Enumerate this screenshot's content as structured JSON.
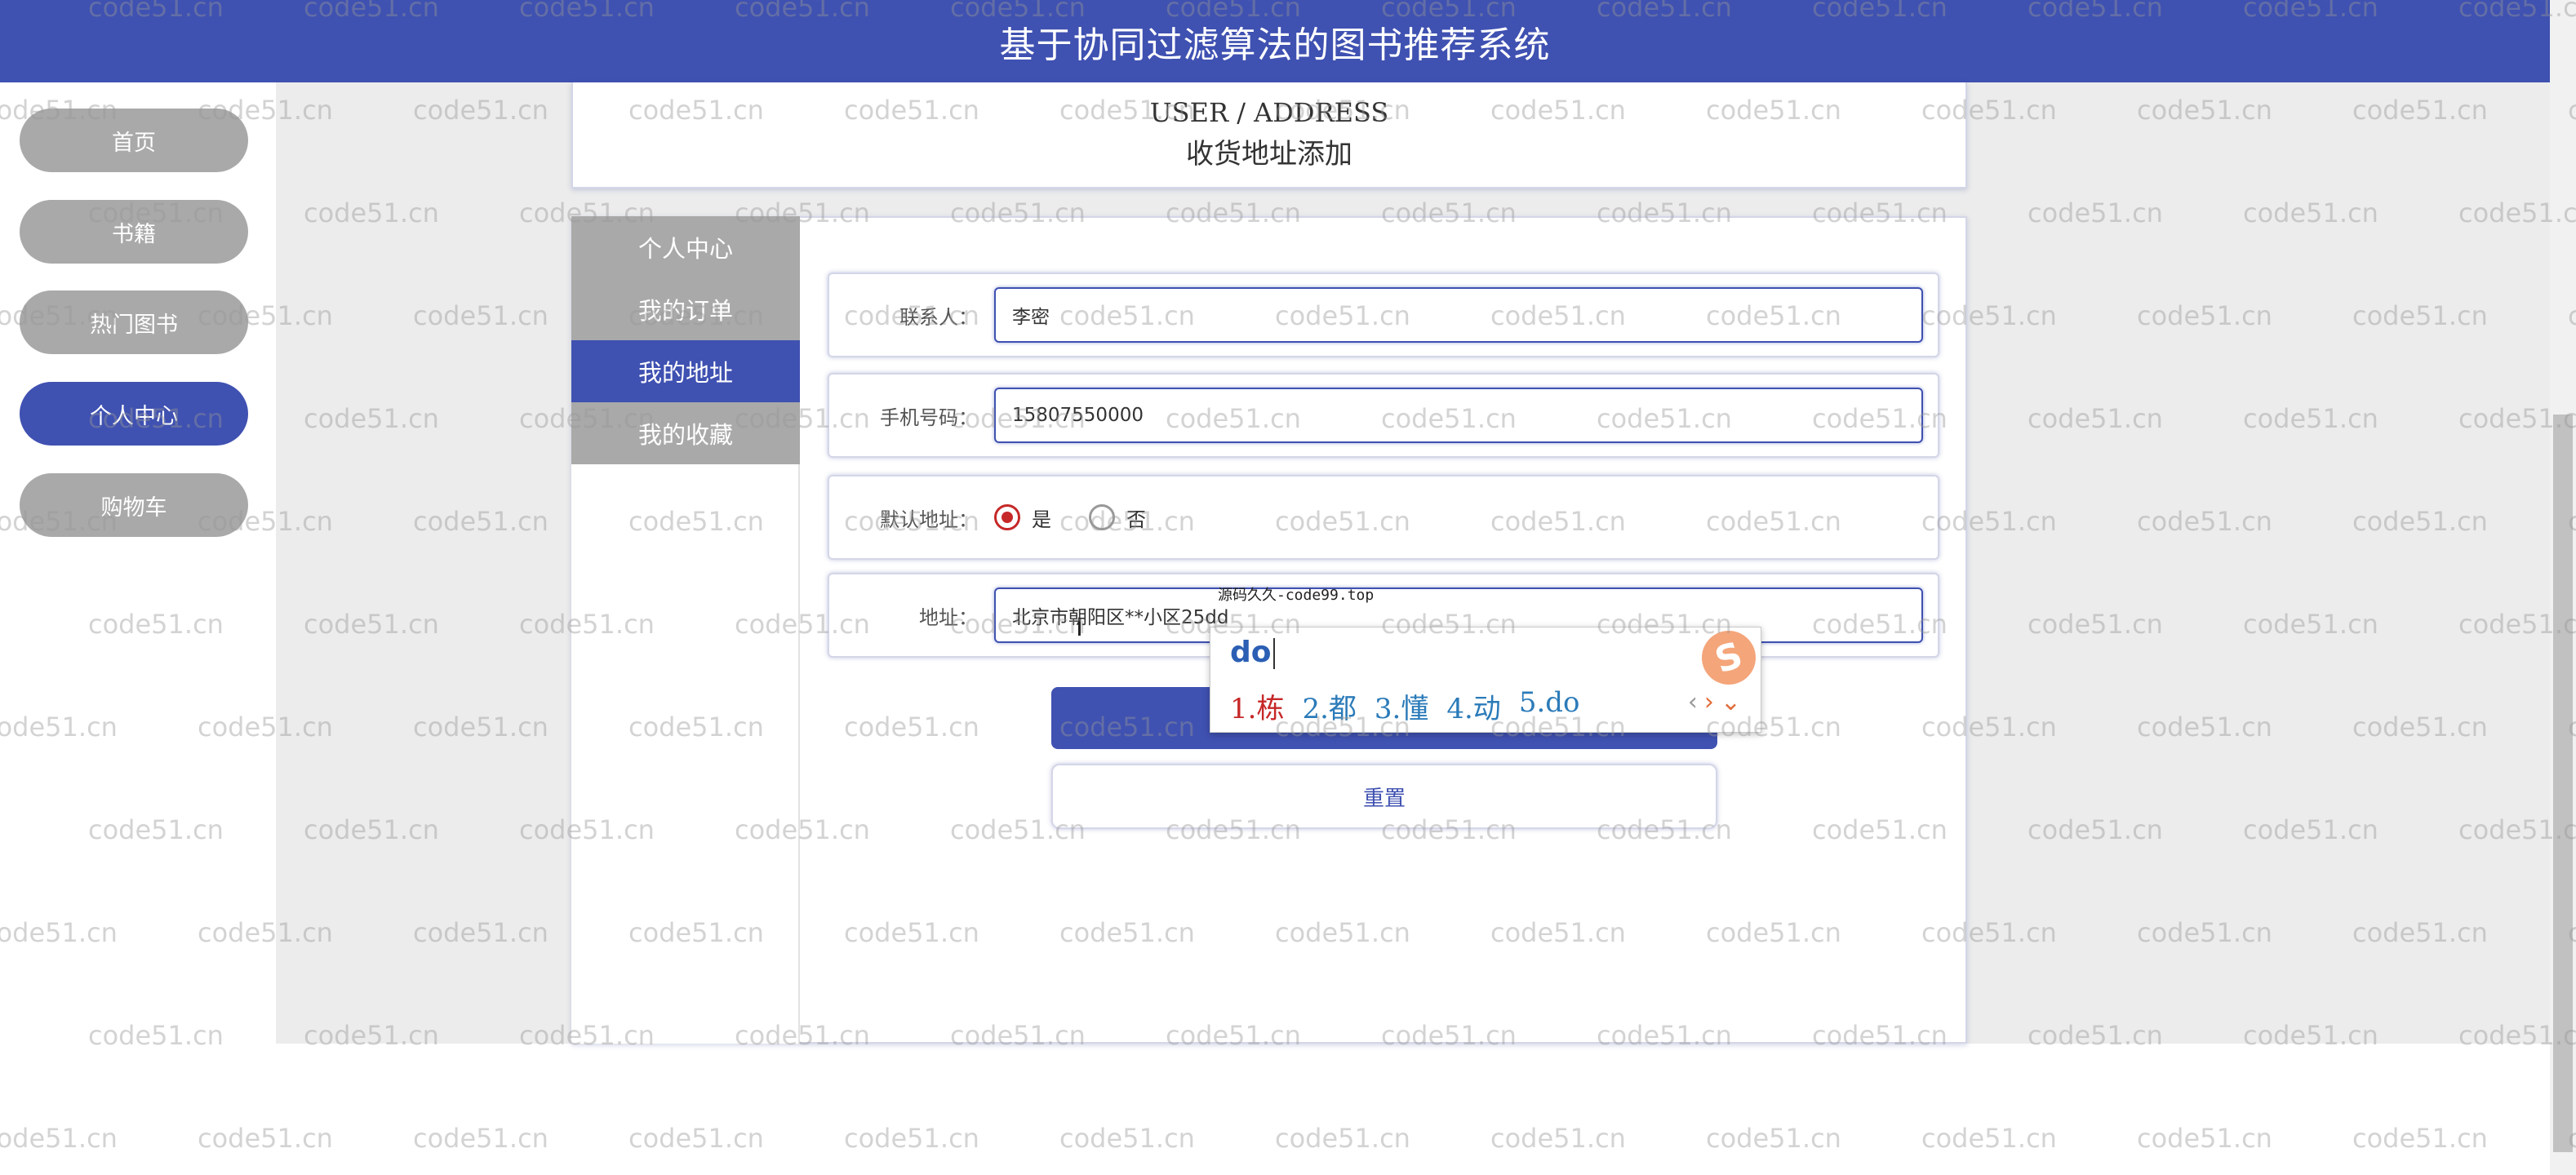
{
  "header": {
    "title": "基于协同过滤算法的图书推荐系统"
  },
  "nav": {
    "items": [
      {
        "label": "首页",
        "active": false
      },
      {
        "label": "书籍",
        "active": false
      },
      {
        "label": "热门图书",
        "active": false
      },
      {
        "label": "个人中心",
        "active": true
      },
      {
        "label": "购物车",
        "active": false
      }
    ]
  },
  "breadcrumb": {
    "path": "USER / ADDRESS",
    "title": "收货地址添加"
  },
  "side_menu": {
    "items": [
      {
        "label": "个人中心",
        "active": false
      },
      {
        "label": "我的订单",
        "active": false
      },
      {
        "label": "我的地址",
        "active": true
      },
      {
        "label": "我的收藏",
        "active": false
      }
    ]
  },
  "form": {
    "contact": {
      "label": "联系人：",
      "value": "李密"
    },
    "phone": {
      "label": "手机号码：",
      "value": "15807550000"
    },
    "default_address": {
      "label": "默认地址：",
      "options": [
        {
          "label": "是",
          "checked": true
        },
        {
          "label": "否",
          "checked": false
        }
      ]
    },
    "address": {
      "label": "地址：",
      "value": "北京市朝阳区**小区25dd"
    },
    "reset_label": "重置"
  },
  "ime": {
    "hint": "源码久久-code99.top",
    "composition": "do",
    "candidates": [
      "1.栋",
      "2.都",
      "3.懂",
      "4.动",
      "5.do"
    ],
    "logo": "S"
  },
  "watermark": {
    "text": "code51.cn"
  },
  "colors": {
    "primary": "#3f51b1",
    "nav_inactive": "#a9a9a9",
    "content_bg": "#ececec",
    "radio_checked": "#c62828"
  }
}
